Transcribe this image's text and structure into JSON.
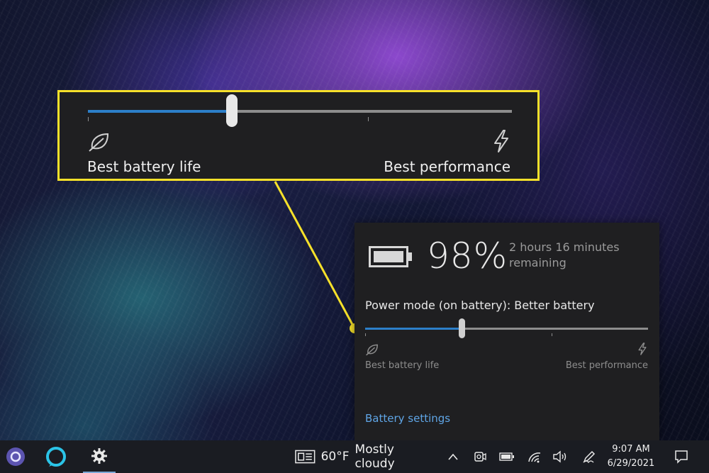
{
  "callout": {
    "left_label": "Best battery life",
    "right_label": "Best performance",
    "slider_level": 0.34,
    "ticks": [
      0.0,
      0.66
    ]
  },
  "flyout": {
    "battery_percent": "98%",
    "remaining_line1": "2 hours 16 minutes",
    "remaining_line2": "remaining",
    "power_mode": "Power mode (on battery): Better battery",
    "slider_level": 0.34,
    "ticks": [
      0.0,
      0.66
    ],
    "left_label": "Best battery life",
    "right_label": "Best performance",
    "settings_link": "Battery settings"
  },
  "taskbar": {
    "weather_temp": "60°F",
    "weather_desc": "Mostly cloudy",
    "time": "9:07 AM",
    "date": "6/29/2021",
    "icons": [
      "cortana-icon",
      "alexa-icon",
      "settings-icon",
      "news-weather-icon",
      "chevron-up-icon",
      "meet-now-icon",
      "battery-icon",
      "wifi-icon",
      "volume-icon",
      "pen-icon",
      "notification-icon"
    ]
  },
  "colors": {
    "accent": "#2c7fc9",
    "callout_border": "#f7e12a",
    "link": "#5fa5e6",
    "panel": "#1f1f21"
  }
}
